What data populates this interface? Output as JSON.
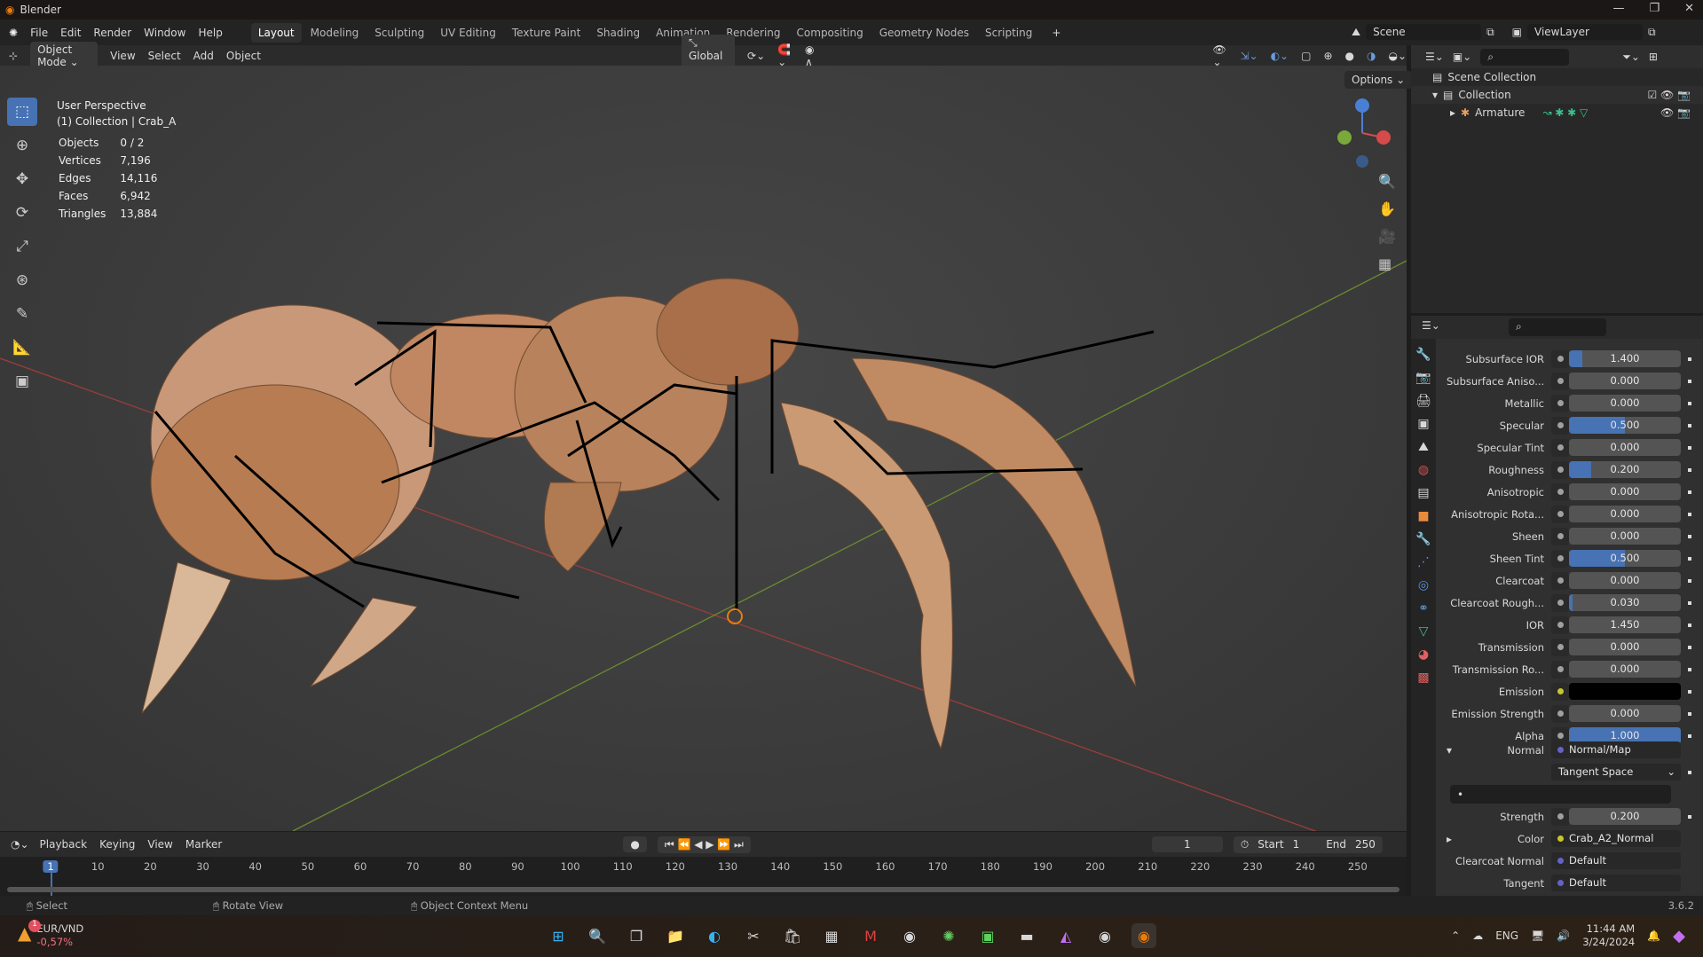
{
  "app": {
    "title": "Blender",
    "version": "3.6.2"
  },
  "menu": [
    "File",
    "Edit",
    "Render",
    "Window",
    "Help"
  ],
  "workspaces": [
    "Layout",
    "Modeling",
    "Sculpting",
    "UV Editing",
    "Texture Paint",
    "Shading",
    "Animation",
    "Rendering",
    "Compositing",
    "Geometry Nodes",
    "Scripting"
  ],
  "scene": {
    "name": "Scene",
    "view_layer": "ViewLayer"
  },
  "viewport_header": {
    "mode": "Object Mode",
    "menus": [
      "View",
      "Select",
      "Add",
      "Object"
    ],
    "orientation": "Global",
    "options": "Options"
  },
  "viewport": {
    "perspective": "User Perspective",
    "collection": "(1) Collection | Crab_A",
    "stats": [
      {
        "k": "Objects",
        "v": "0 / 2"
      },
      {
        "k": "Vertices",
        "v": "7,196"
      },
      {
        "k": "Edges",
        "v": "14,116"
      },
      {
        "k": "Faces",
        "v": "6,942"
      },
      {
        "k": "Triangles",
        "v": "13,884"
      }
    ]
  },
  "outliner": {
    "scene_collection": "Scene Collection",
    "collection": "Collection",
    "armature": "Armature"
  },
  "properties": [
    {
      "label": "Subsurface IOR",
      "value": "1.400",
      "fill": 0.12
    },
    {
      "label": "Subsurface Aniso...",
      "value": "0.000",
      "fill": 0
    },
    {
      "label": "Metallic",
      "value": "0.000",
      "fill": 0
    },
    {
      "label": "Specular",
      "value": "0.500",
      "fill": 0.5
    },
    {
      "label": "Specular Tint",
      "value": "0.000",
      "fill": 0
    },
    {
      "label": "Roughness",
      "value": "0.200",
      "fill": 0.2
    },
    {
      "label": "Anisotropic",
      "value": "0.000",
      "fill": 0
    },
    {
      "label": "Anisotropic Rota...",
      "value": "0.000",
      "fill": 0
    },
    {
      "label": "Sheen",
      "value": "0.000",
      "fill": 0
    },
    {
      "label": "Sheen Tint",
      "value": "0.500",
      "fill": 0.5
    },
    {
      "label": "Clearcoat",
      "value": "0.000",
      "fill": 0
    },
    {
      "label": "Clearcoat Rough...",
      "value": "0.030",
      "fill": 0.03
    },
    {
      "label": "IOR",
      "value": "1.450",
      "fill": 0
    },
    {
      "label": "Transmission",
      "value": "0.000",
      "fill": 0
    },
    {
      "label": "Transmission Ro...",
      "value": "0.000",
      "fill": 0
    },
    {
      "label": "Emission",
      "value": "",
      "color": "#000000"
    },
    {
      "label": "Emission Strength",
      "value": "0.000",
      "fill": 0
    },
    {
      "label": "Alpha",
      "value": "1.000",
      "fill": 1
    }
  ],
  "normal": {
    "label": "Normal",
    "node": "Normal/Map",
    "space": "Tangent Space",
    "strength_label": "Strength",
    "strength": "0.200",
    "color_label": "Color",
    "color_node": "Crab_A2_Normal",
    "clearcoat_label": "Clearcoat Normal",
    "clearcoat": "Default",
    "tangent_label": "Tangent",
    "tangent": "Default"
  },
  "timeline": {
    "menus": [
      "Playback",
      "Keying",
      "View",
      "Marker"
    ],
    "current": "1",
    "start_label": "Start",
    "start": "1",
    "end_label": "End",
    "end": "250",
    "ticks": [
      "1",
      "10",
      "20",
      "30",
      "40",
      "50",
      "60",
      "70",
      "80",
      "90",
      "100",
      "110",
      "120",
      "130",
      "140",
      "150",
      "160",
      "170",
      "180",
      "190",
      "200",
      "210",
      "220",
      "230",
      "240",
      "250"
    ]
  },
  "status": [
    "Select",
    "Rotate View",
    "Object Context Menu"
  ],
  "taskbar": {
    "ticker": "EUR/VND",
    "change": "-0,57%",
    "badge": "1",
    "lang": "ENG",
    "time": "11:44 AM",
    "date": "3/24/2024"
  },
  "colors": {
    "accent": "#4772b3",
    "socket_grey": "#a0a0a0",
    "socket_yellow": "#c7c729",
    "socket_purple": "#6363c7"
  }
}
